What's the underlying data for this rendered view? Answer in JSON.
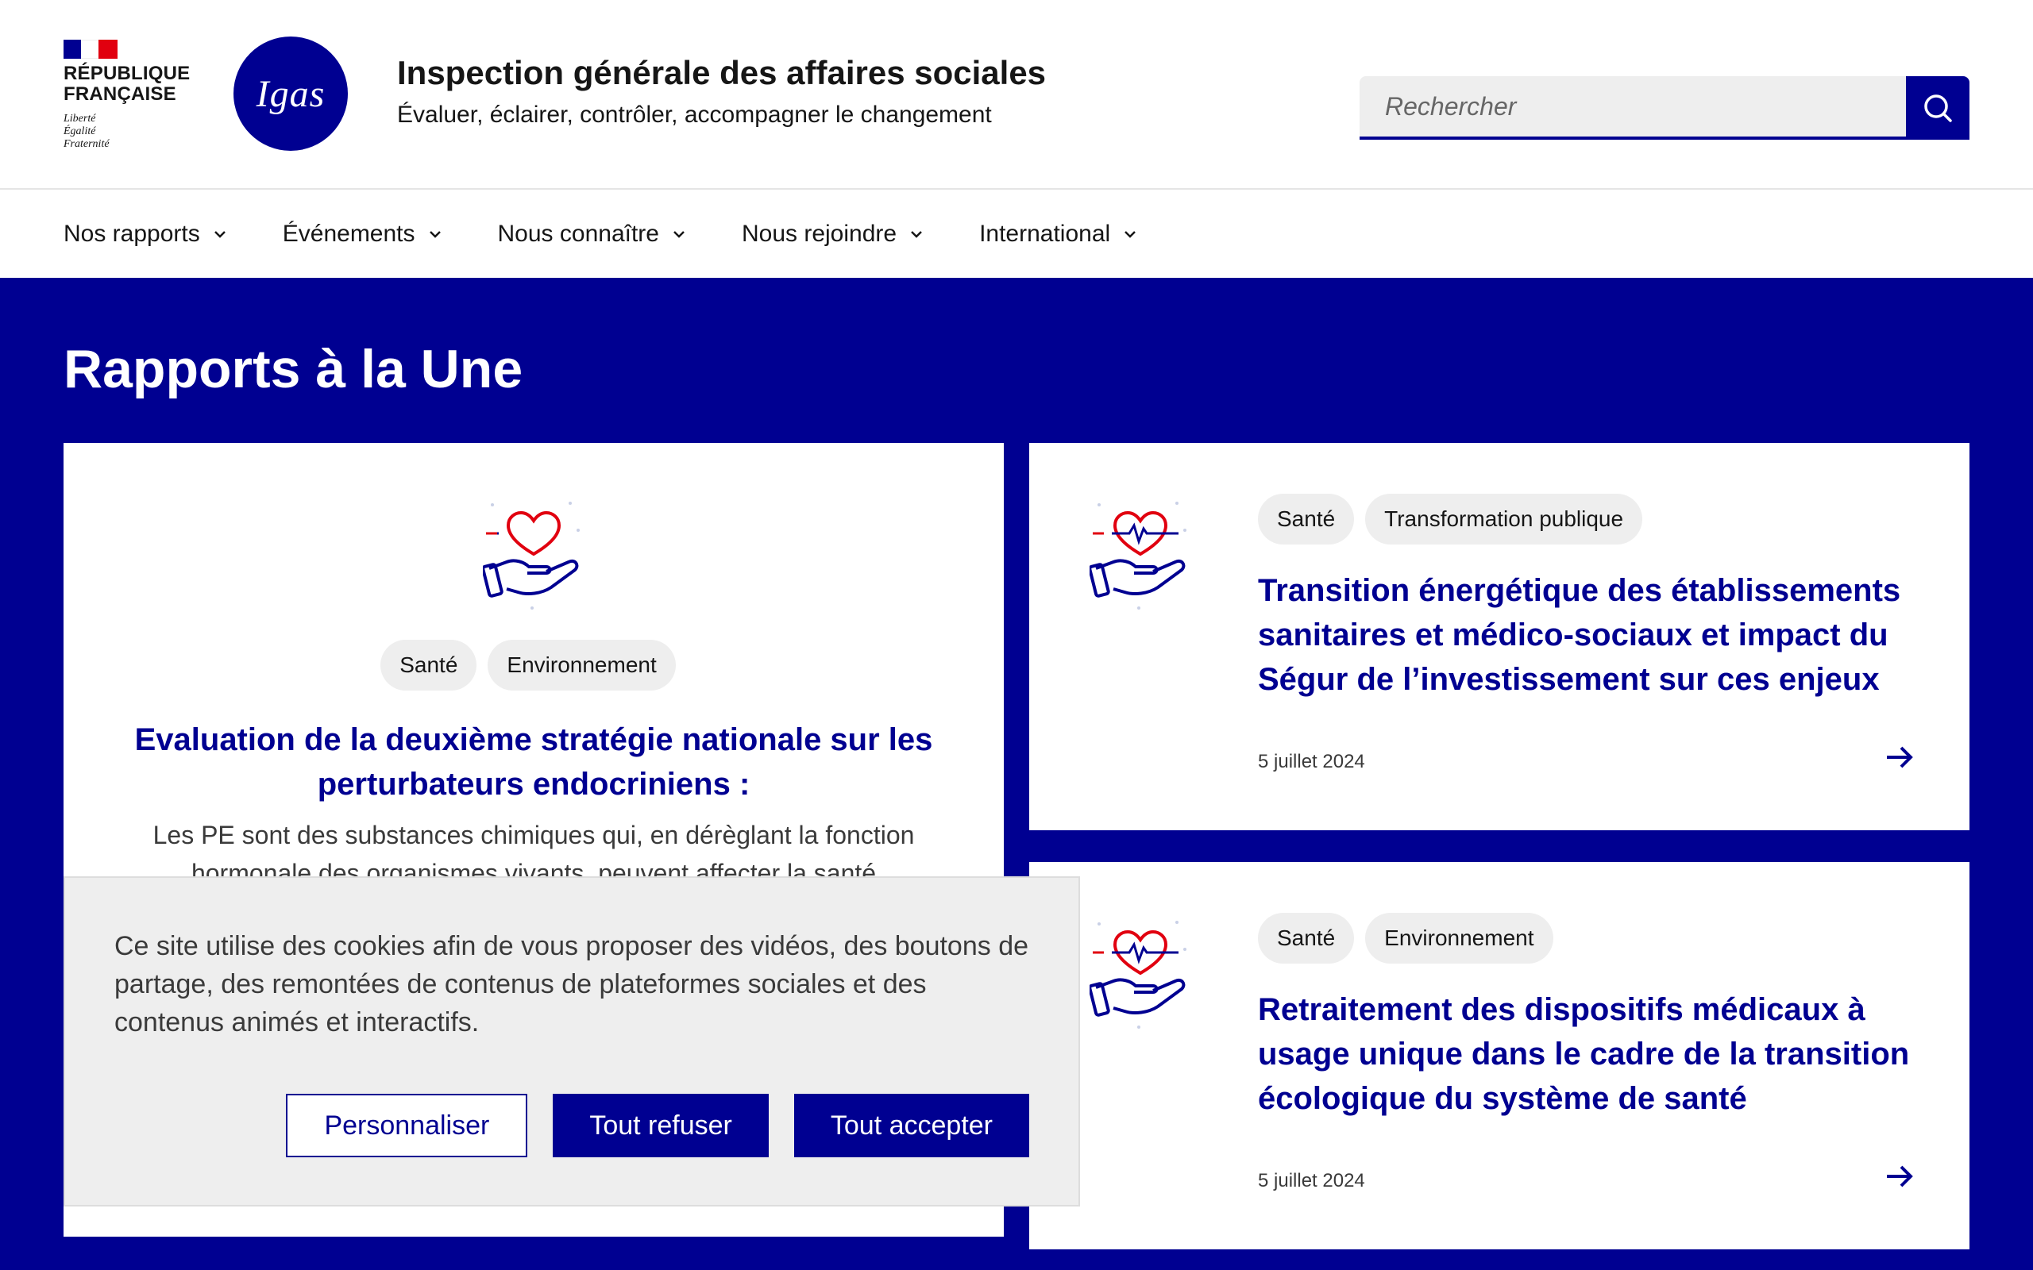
{
  "brand": {
    "republique_line1": "République",
    "republique_line2": "Française",
    "devise": [
      "Liberté",
      "Égalité",
      "Fraternité"
    ],
    "logo_text": "Igas",
    "site_title": "Inspection générale des affaires sociales",
    "tagline": "Évaluer, éclairer, contrôler, accompagner le changement",
    "primary_color": "#000091",
    "flag_red": "#e1000f"
  },
  "search": {
    "placeholder": "Rechercher",
    "button_icon": "search-icon"
  },
  "nav": {
    "items": [
      {
        "label": "Nos rapports"
      },
      {
        "label": "Événements"
      },
      {
        "label": "Nous connaître"
      },
      {
        "label": "Nous rejoindre"
      },
      {
        "label": "International"
      }
    ]
  },
  "main": {
    "section_title": "Rapports à la Une",
    "featured": {
      "icon": "health-heart-hand-icon",
      "tags": [
        "Santé",
        "Environnement"
      ],
      "title": "Evaluation de la deuxième stratégie nationale sur les perturbateurs endocriniens :",
      "description": "Les PE sont des substances chimiques qui, en dérèglant la fonction hormonale des organismes vivants, peuvent affecter la santé"
    },
    "cards": [
      {
        "icon": "health-heart-hand-icon",
        "tags": [
          "Santé",
          "Transformation publique"
        ],
        "title": "Transition énergétique des établissements sanitaires et médico-sociaux et impact du Ségur de l’investissement sur ces enjeux",
        "date": "5 juillet 2024"
      },
      {
        "icon": "health-heart-hand-icon",
        "tags": [
          "Santé",
          "Environnement"
        ],
        "title": "Retraitement des dispositifs médicaux à usage unique dans le cadre de la transition écologique du système de santé",
        "date": "5 juillet 2024"
      }
    ]
  },
  "cookie_banner": {
    "text": "Ce site utilise des cookies afin de vous proposer des vidéos, des boutons de partage, des remontées de contenus de plateformes sociales et des contenus animés et interactifs.",
    "personalize_label": "Personnaliser",
    "refuse_label": "Tout refuser",
    "accept_label": "Tout accepter"
  }
}
